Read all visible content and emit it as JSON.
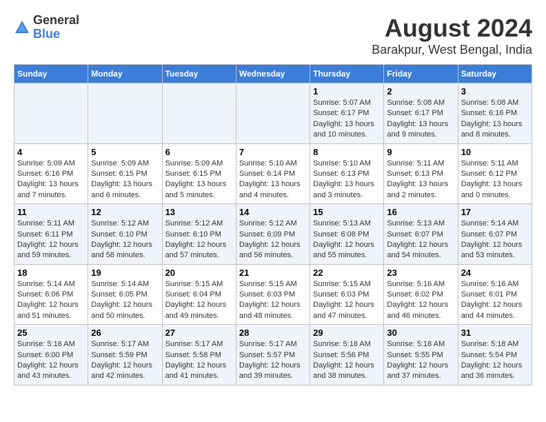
{
  "header": {
    "logo_general": "General",
    "logo_blue": "Blue",
    "main_title": "August 2024",
    "subtitle": "Barakpur, West Bengal, India"
  },
  "days_of_week": [
    "Sunday",
    "Monday",
    "Tuesday",
    "Wednesday",
    "Thursday",
    "Friday",
    "Saturday"
  ],
  "weeks": [
    {
      "days": [
        {
          "num": "",
          "detail": ""
        },
        {
          "num": "",
          "detail": ""
        },
        {
          "num": "",
          "detail": ""
        },
        {
          "num": "",
          "detail": ""
        },
        {
          "num": "1",
          "detail": "Sunrise: 5:07 AM\nSunset: 6:17 PM\nDaylight: 13 hours\nand 10 minutes."
        },
        {
          "num": "2",
          "detail": "Sunrise: 5:08 AM\nSunset: 6:17 PM\nDaylight: 13 hours\nand 9 minutes."
        },
        {
          "num": "3",
          "detail": "Sunrise: 5:08 AM\nSunset: 6:16 PM\nDaylight: 13 hours\nand 8 minutes."
        }
      ]
    },
    {
      "days": [
        {
          "num": "4",
          "detail": "Sunrise: 5:09 AM\nSunset: 6:16 PM\nDaylight: 13 hours\nand 7 minutes."
        },
        {
          "num": "5",
          "detail": "Sunrise: 5:09 AM\nSunset: 6:15 PM\nDaylight: 13 hours\nand 6 minutes."
        },
        {
          "num": "6",
          "detail": "Sunrise: 5:09 AM\nSunset: 6:15 PM\nDaylight: 13 hours\nand 5 minutes."
        },
        {
          "num": "7",
          "detail": "Sunrise: 5:10 AM\nSunset: 6:14 PM\nDaylight: 13 hours\nand 4 minutes."
        },
        {
          "num": "8",
          "detail": "Sunrise: 5:10 AM\nSunset: 6:13 PM\nDaylight: 13 hours\nand 3 minutes."
        },
        {
          "num": "9",
          "detail": "Sunrise: 5:11 AM\nSunset: 6:13 PM\nDaylight: 13 hours\nand 2 minutes."
        },
        {
          "num": "10",
          "detail": "Sunrise: 5:11 AM\nSunset: 6:12 PM\nDaylight: 13 hours\nand 0 minutes."
        }
      ]
    },
    {
      "days": [
        {
          "num": "11",
          "detail": "Sunrise: 5:11 AM\nSunset: 6:11 PM\nDaylight: 12 hours\nand 59 minutes."
        },
        {
          "num": "12",
          "detail": "Sunrise: 5:12 AM\nSunset: 6:10 PM\nDaylight: 12 hours\nand 58 minutes."
        },
        {
          "num": "13",
          "detail": "Sunrise: 5:12 AM\nSunset: 6:10 PM\nDaylight: 12 hours\nand 57 minutes."
        },
        {
          "num": "14",
          "detail": "Sunrise: 5:12 AM\nSunset: 6:09 PM\nDaylight: 12 hours\nand 56 minutes."
        },
        {
          "num": "15",
          "detail": "Sunrise: 5:13 AM\nSunset: 6:08 PM\nDaylight: 12 hours\nand 55 minutes."
        },
        {
          "num": "16",
          "detail": "Sunrise: 5:13 AM\nSunset: 6:07 PM\nDaylight: 12 hours\nand 54 minutes."
        },
        {
          "num": "17",
          "detail": "Sunrise: 5:14 AM\nSunset: 6:07 PM\nDaylight: 12 hours\nand 53 minutes."
        }
      ]
    },
    {
      "days": [
        {
          "num": "18",
          "detail": "Sunrise: 5:14 AM\nSunset: 6:06 PM\nDaylight: 12 hours\nand 51 minutes."
        },
        {
          "num": "19",
          "detail": "Sunrise: 5:14 AM\nSunset: 6:05 PM\nDaylight: 12 hours\nand 50 minutes."
        },
        {
          "num": "20",
          "detail": "Sunrise: 5:15 AM\nSunset: 6:04 PM\nDaylight: 12 hours\nand 49 minutes."
        },
        {
          "num": "21",
          "detail": "Sunrise: 5:15 AM\nSunset: 6:03 PM\nDaylight: 12 hours\nand 48 minutes."
        },
        {
          "num": "22",
          "detail": "Sunrise: 5:15 AM\nSunset: 6:03 PM\nDaylight: 12 hours\nand 47 minutes."
        },
        {
          "num": "23",
          "detail": "Sunrise: 5:16 AM\nSunset: 6:02 PM\nDaylight: 12 hours\nand 46 minutes."
        },
        {
          "num": "24",
          "detail": "Sunrise: 5:16 AM\nSunset: 6:01 PM\nDaylight: 12 hours\nand 44 minutes."
        }
      ]
    },
    {
      "days": [
        {
          "num": "25",
          "detail": "Sunrise: 5:16 AM\nSunset: 6:00 PM\nDaylight: 12 hours\nand 43 minutes."
        },
        {
          "num": "26",
          "detail": "Sunrise: 5:17 AM\nSunset: 5:59 PM\nDaylight: 12 hours\nand 42 minutes."
        },
        {
          "num": "27",
          "detail": "Sunrise: 5:17 AM\nSunset: 5:58 PM\nDaylight: 12 hours\nand 41 minutes."
        },
        {
          "num": "28",
          "detail": "Sunrise: 5:17 AM\nSunset: 5:57 PM\nDaylight: 12 hours\nand 39 minutes."
        },
        {
          "num": "29",
          "detail": "Sunrise: 5:18 AM\nSunset: 5:56 PM\nDaylight: 12 hours\nand 38 minutes."
        },
        {
          "num": "30",
          "detail": "Sunrise: 5:18 AM\nSunset: 5:55 PM\nDaylight: 12 hours\nand 37 minutes."
        },
        {
          "num": "31",
          "detail": "Sunrise: 5:18 AM\nSunset: 5:54 PM\nDaylight: 12 hours\nand 36 minutes."
        }
      ]
    }
  ]
}
